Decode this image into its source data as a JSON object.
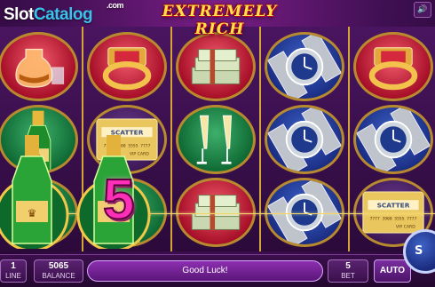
{
  "header": {
    "watermark_part1": "Slot",
    "watermark_part2": "Catalog",
    "watermark_part3": ".com",
    "game_title": "EXTREMELY RICH",
    "sound_icon": "speaker-icon"
  },
  "reels": {
    "symbols": [
      [
        "cognac-glass",
        "champagne-bottle",
        "champagne-bottle"
      ],
      [
        "gold-ring",
        "scatter-vip-card",
        "champagne-bottle"
      ],
      [
        "money-stack",
        "champagne-glasses",
        "money-stack"
      ],
      [
        "gold-watch",
        "gold-watch",
        "gold-watch"
      ],
      [
        "gold-ring",
        "gold-watch",
        "scatter-vip-card"
      ]
    ],
    "scatter_text": "SCATTER",
    "vip_text": "VIP CARD",
    "card_number": "7777 3908 5555 7777"
  },
  "win": {
    "big_number": "5",
    "symbol": "champagne-bottle"
  },
  "bottom_bar": {
    "lines_value": "1",
    "lines_label": "LINE",
    "balance_value": "5065",
    "balance_label": "BALANCE",
    "message": "Good Luck!",
    "bet_value": "5",
    "bet_label": "BET",
    "auto_label": "AUTO",
    "spin_label": "S"
  },
  "colors": {
    "background": "#3f0f52",
    "reel_frame": "#d4a437",
    "title": "#ffe24a",
    "watermark_accent": "#39c2ea",
    "win_number": "#ff2fb7"
  }
}
